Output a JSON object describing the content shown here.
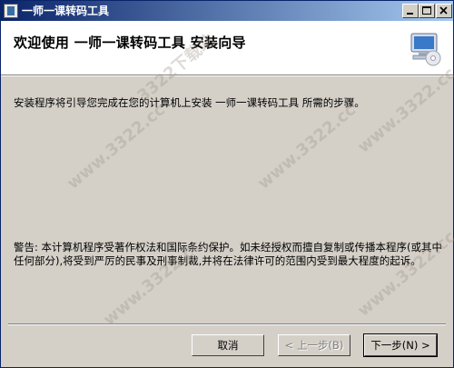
{
  "window": {
    "title": "一师一课转码工具",
    "controls": [
      "minimize-icon",
      "maximize-icon",
      "close-icon"
    ]
  },
  "header": {
    "title": "欢迎使用 一师一课转码工具 安装向导",
    "icon": "computer-cd-icon"
  },
  "body": {
    "intro": "安装程序将引导您完成在您的计算机上安装 一师一课转码工具 所需的步骤。",
    "warning": "警告: 本计算机程序受著作权法和国际条约保护。如未经授权而擅自复制或传播本程序(或其中任何部分),将受到严厉的民事及刑事制裁,并将在法律许可的范围内受到最大程度的起诉。"
  },
  "buttons": {
    "cancel": "取消",
    "back": "< 上一步(B)",
    "next": "下一步(N) >"
  },
  "watermark": "www.3322.cc",
  "watermark2": "3322下载站"
}
